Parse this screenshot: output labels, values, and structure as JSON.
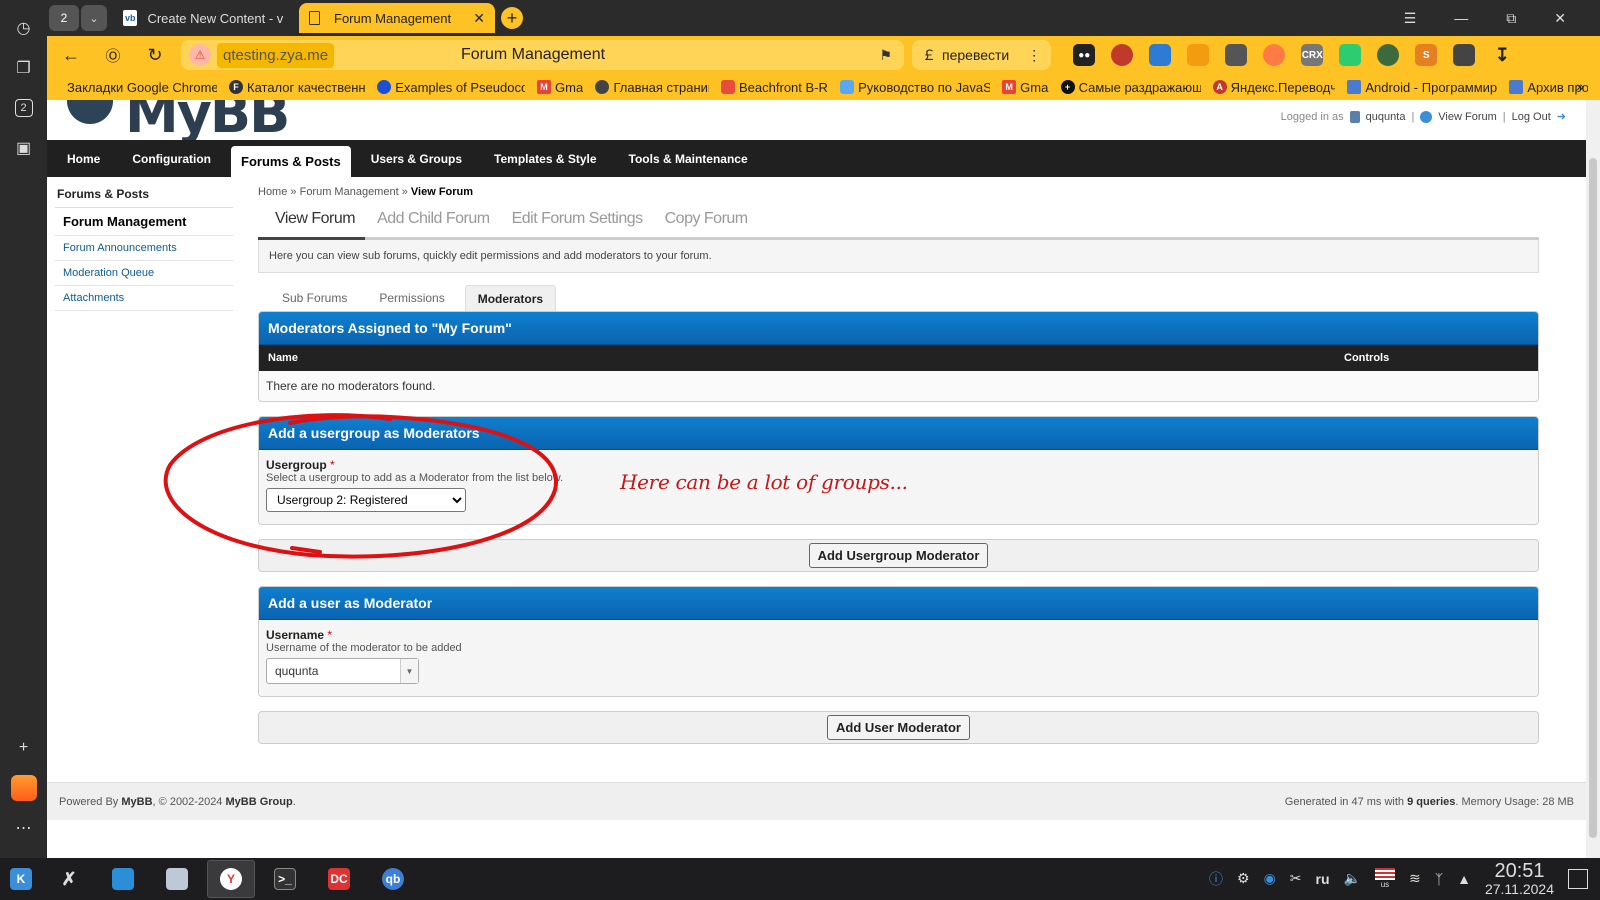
{
  "browser": {
    "tab_count": "2",
    "tabs": [
      {
        "label": "Create New Content - vBulletin",
        "favicon": "vb"
      },
      {
        "label": "Forum Management"
      }
    ],
    "address": {
      "host": "qtesting.zya.me",
      "page_title": "Forum Management"
    },
    "translate_label": "перевести",
    "side_badge": "2",
    "bookmarks": [
      "Закладки Google Chrome",
      "Каталог качественных",
      "Examples of Pseudocode",
      "Gmail",
      "Главная страница",
      "Beachfront B-Roll",
      "Руководство по JavaScript",
      "Gmail",
      "Самые раздражающие",
      "Яндекс.Переводчик",
      "Android - Программирование",
      "Архив программ"
    ]
  },
  "mybb": {
    "logo": "MyBB",
    "userbar": {
      "logged_in_as": "Logged in as",
      "username": "ququnta",
      "view_forum": "View Forum",
      "logout": "Log Out"
    },
    "nav": [
      "Home",
      "Configuration",
      "Forums & Posts",
      "Users & Groups",
      "Templates & Style",
      "Tools & Maintenance"
    ],
    "left_menu": {
      "title": "Forums & Posts",
      "items": [
        "Forum Management",
        "Forum Announcements",
        "Moderation Queue",
        "Attachments"
      ]
    },
    "breadcrumb": {
      "home": "Home",
      "sep": "»",
      "forum_management": "Forum Management",
      "current": "View Forum"
    },
    "page_tabs": [
      "View Forum",
      "Add Child Forum",
      "Edit Forum Settings",
      "Copy Forum"
    ],
    "description": "Here you can view sub forums, quickly edit permissions and add moderators to your forum.",
    "sub_tabs": [
      "Sub Forums",
      "Permissions",
      "Moderators"
    ],
    "moderators_panel": {
      "title": "Moderators Assigned to \"My Forum\"",
      "col_name": "Name",
      "col_controls": "Controls",
      "empty": "There are no moderators found."
    },
    "usergroup_panel": {
      "title": "Add a usergroup as Moderators",
      "label": "Usergroup",
      "required": "*",
      "desc": "Select a usergroup to add as a Moderator from the list below.",
      "selected": "Usergroup 2: Registered",
      "button": "Add Usergroup Moderator"
    },
    "user_panel": {
      "title": "Add a user as Moderator",
      "label": "Username",
      "required": "*",
      "desc": "Username of the moderator to be added",
      "value": "ququnta",
      "button": "Add User Moderator"
    },
    "annotation": "Here can be a lot of groups...",
    "footer": {
      "powered_prefix": "Powered By",
      "mybb": "MyBB",
      "copyright": ", © 2002-2024",
      "group": "MyBB Group",
      "generated_prefix": "Generated in 47 ms with",
      "queries": "9 queries",
      "memory": ". Memory Usage: 28 MB"
    }
  },
  "taskbar": {
    "lang": "ru",
    "kb": "us",
    "time": "20:51",
    "date": "27.11.2024"
  },
  "colors": {
    "browser_accent": "#ffc224",
    "panel_head": "#0a6dbd",
    "annotation": "#c21818"
  }
}
